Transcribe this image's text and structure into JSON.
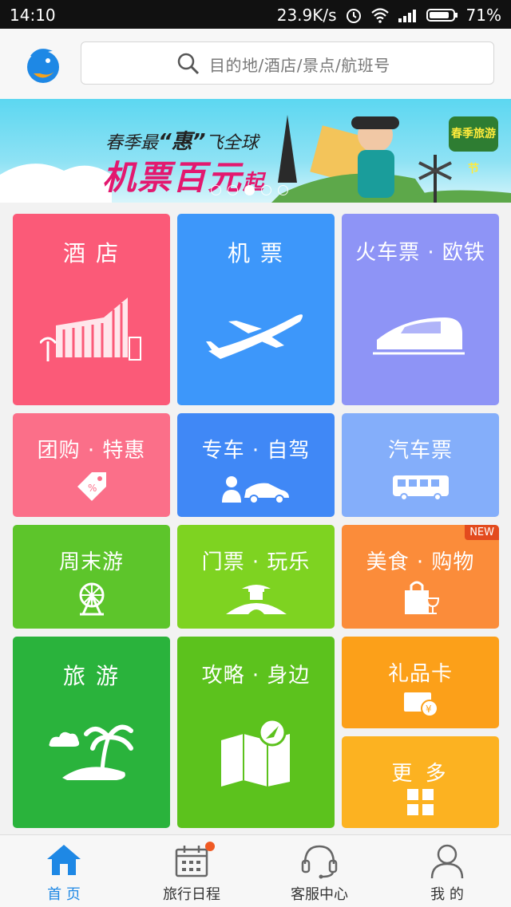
{
  "status_bar": {
    "time": "14:10",
    "speed": "23.9K/s",
    "battery": "71%"
  },
  "header": {
    "search_placeholder": "目的地/酒店/景点/航班号"
  },
  "banner": {
    "subtitle_pre": "春季最",
    "subtitle_emph": "“惠”",
    "subtitle_post": "飞全球",
    "headline": "机票百元",
    "headline_suffix": "起",
    "badge": "春季旅游节",
    "slides": 5,
    "active_slide": 3
  },
  "tiles": {
    "hotel": {
      "label": "酒 店",
      "color": "#fb5a78",
      "icon": "hotel-building-icon"
    },
    "flight": {
      "label": "机 票",
      "color": "#3d97fa",
      "icon": "airplane-icon"
    },
    "train": {
      "label": "火车票 · 欧铁",
      "color": "#8e94f6",
      "icon": "train-icon"
    },
    "group": {
      "label": "团购 · 特惠",
      "color": "#fb6f89",
      "icon": "tag-icon"
    },
    "car": {
      "label": "专车 · 自驾",
      "color": "#4088f6",
      "icon": "car-icon"
    },
    "bus": {
      "label": "汽车票",
      "color": "#84aefa",
      "icon": "bus-icon"
    },
    "weekend": {
      "label": "周末游",
      "color": "#5dc52b",
      "icon": "ferris-wheel-icon"
    },
    "tickets": {
      "label": "门票 · 玩乐",
      "color": "#7ed321",
      "icon": "pavilion-icon"
    },
    "food": {
      "label": "美食 · 购物",
      "color": "#fb8c3a",
      "icon": "shopping-bag-icon",
      "badge": "NEW"
    },
    "travel": {
      "label": "旅 游",
      "color": "#2ab33c",
      "icon": "palm-island-icon"
    },
    "guide": {
      "label": "攻略 · 身边",
      "color": "#5cc21d",
      "icon": "map-icon"
    },
    "giftcard": {
      "label": "礼品卡",
      "color": "#fca019",
      "icon": "gift-card-icon"
    },
    "more": {
      "label": "更 多",
      "color": "#fcb221",
      "icon": "grid-icon"
    }
  },
  "tabbar": [
    {
      "label": "首 页",
      "icon": "home-icon",
      "active": true
    },
    {
      "label": "旅行日程",
      "icon": "calendar-icon",
      "active": false
    },
    {
      "label": "客服中心",
      "icon": "headset-icon",
      "active": false
    },
    {
      "label": "我 的",
      "icon": "user-icon",
      "active": false
    }
  ],
  "colors": {
    "accent": "#1e88e5",
    "notification": "#f05a24"
  }
}
